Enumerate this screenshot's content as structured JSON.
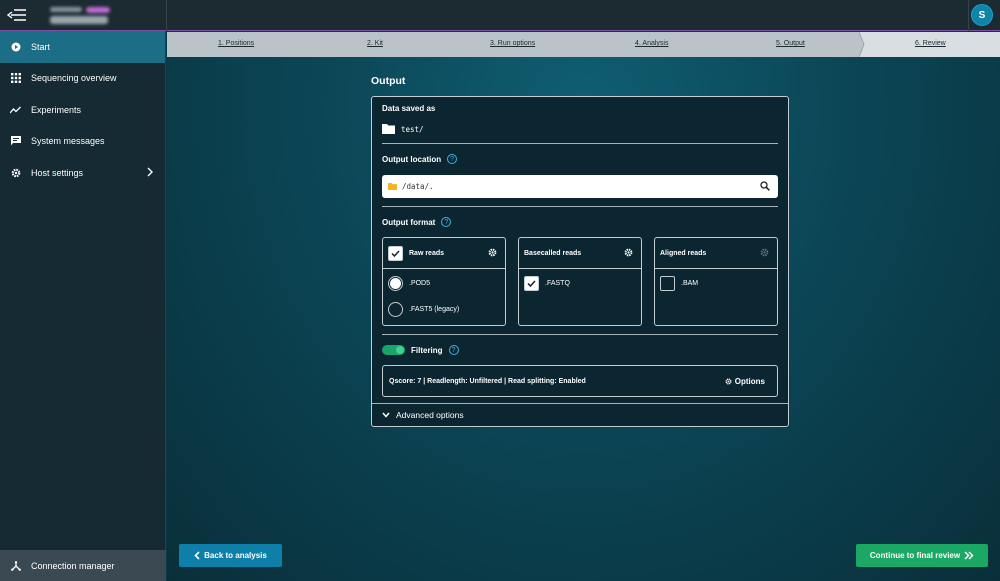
{
  "header": {
    "avatar_initial": "S"
  },
  "sidebar": {
    "items": [
      {
        "label": "Start",
        "icon": "play-circle-icon"
      },
      {
        "label": "Sequencing overview",
        "icon": "grid-icon"
      },
      {
        "label": "Experiments",
        "icon": "trend-icon"
      },
      {
        "label": "System messages",
        "icon": "message-icon"
      },
      {
        "label": "Host settings",
        "icon": "gear-icon"
      }
    ],
    "connection_manager": "Connection manager"
  },
  "stepper": {
    "steps": [
      "1. Positions",
      "2. Kit",
      "3. Run options",
      "4. Analysis",
      "5. Output",
      "6. Review"
    ]
  },
  "output": {
    "title": "Output",
    "data_saved_label": "Data saved as",
    "data_saved_value": "test/",
    "output_location_label": "Output location",
    "output_location_value": "/data/.",
    "output_format_label": "Output format",
    "raw_reads": {
      "label": "Raw reads",
      "checked": true,
      "options": [
        {
          "label": ".POD5",
          "selected": true
        },
        {
          "label": ".FAST5 (legacy)",
          "selected": false
        }
      ]
    },
    "basecalled_reads": {
      "label": "Basecalled reads",
      "options": [
        {
          "label": ".FASTQ",
          "checked": true
        }
      ]
    },
    "aligned_reads": {
      "label": "Aligned reads",
      "options": [
        {
          "label": ".BAM",
          "checked": false
        }
      ]
    },
    "filtering": {
      "label": "Filtering",
      "enabled": true,
      "summary": "Qscore: 7 | Readlength: Unfiltered | Read splitting: Enabled",
      "options_label": "Options"
    },
    "advanced_label": "Advanced options"
  },
  "footer": {
    "back_label": "Back to analysis",
    "continue_label": "Continue to final review"
  },
  "colors": {
    "accent": "#0e7fa8",
    "success": "#1ba865",
    "sidebar_active": "#1b6e86"
  }
}
